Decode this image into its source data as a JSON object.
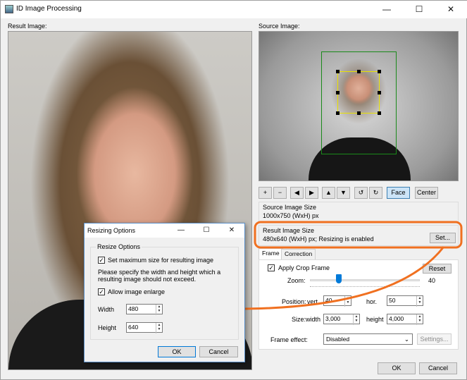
{
  "window": {
    "title": "ID Image Processing",
    "minimize": "—",
    "maximize": "☐",
    "close": "✕"
  },
  "result_image_label": "Result Image:",
  "source_image_label": "Source Image:",
  "toolbar": {
    "plus": "+",
    "minus": "−",
    "left": "◀",
    "right": "▶",
    "up": "▲",
    "down": "▼",
    "rotate_ccw": "↺",
    "rotate_cw": "↻",
    "face": "Face",
    "center": "Center"
  },
  "source_image_size": {
    "title": "Source Image Size",
    "value": "1000x750 (WxH) px"
  },
  "result_image_size": {
    "title": "Result Image Size",
    "value": "480x640 (WxH) px; Resizing is enabled",
    "set_button": "Set..."
  },
  "tabs": {
    "frame": "Frame",
    "correction": "Correction"
  },
  "frame": {
    "apply_crop_frame": "Apply Crop Frame",
    "reset": "Reset",
    "zoom_label": "Zoom:",
    "zoom_value": "40",
    "position_label": "Position:",
    "vert_label": "vert.",
    "vert_value": "40",
    "hor_label": "hor.",
    "hor_value": "50",
    "size_label": "Size:",
    "width_label": "width",
    "width_value": "3,000",
    "height_label": "height",
    "height_value": "4,000",
    "frame_effect_label": "Frame effect:",
    "frame_effect_value": "Disabled",
    "settings_button": "Settings..."
  },
  "footer": {
    "ok": "OK",
    "cancel": "Cancel"
  },
  "dialog": {
    "title": "Resizing Options",
    "minimize": "—",
    "maximize": "☐",
    "close": "✕",
    "group_title": "Resize Options",
    "set_max_size": "Set maximum size for resulting image",
    "description": "Please specify the width and height which a resulting image should not exceed.",
    "allow_enlarge": "Allow image enlarge",
    "width_label": "Width",
    "width_value": "480",
    "height_label": "Height",
    "height_value": "640",
    "ok": "OK",
    "cancel": "Cancel"
  },
  "accent_color": "#f07020"
}
